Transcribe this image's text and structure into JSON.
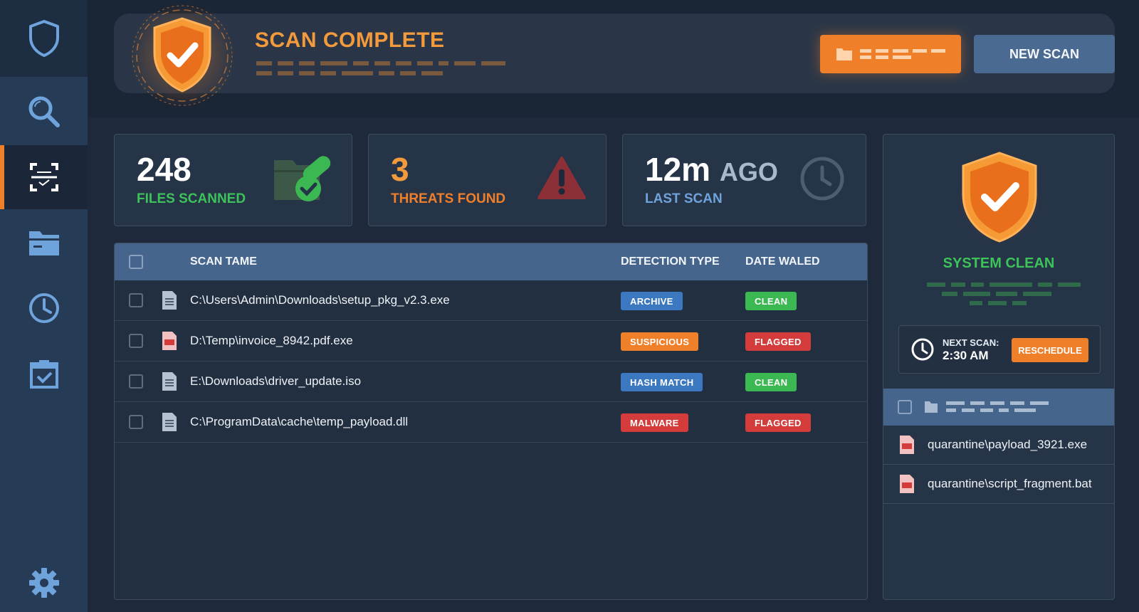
{
  "header": {
    "title": "SCAN COMPLETE",
    "new_scan_label": "NEW SCAN"
  },
  "stats": [
    {
      "value": "248",
      "label": "FILES SCANNED",
      "icon": "folder-check-icon"
    },
    {
      "value": "3",
      "label": "THREATS FOUND",
      "icon": "warning-icon"
    },
    {
      "value": "12m",
      "value_suffix": "AGO",
      "label": "LAST SCAN",
      "icon": "clock-icon"
    }
  ],
  "table": {
    "columns": [
      "SCAN TAME",
      "DETECTION TYPE",
      "DATE WALED"
    ],
    "rows": [
      {
        "path": "C:\\Users\\Admin\\Downloads\\setup_pkg_v2.3.exe",
        "detection": "ARCHIVE",
        "status": "CLEAN",
        "file_icon": "document-icon"
      },
      {
        "path": "D:\\Temp\\invoice_8942.pdf.exe",
        "detection": "SUSPICIOUS",
        "status": "FLAGGED",
        "file_icon": "pdf-file-icon"
      },
      {
        "path": "E:\\Downloads\\driver_update.iso",
        "detection": "HASH MATCH",
        "status": "CLEAN",
        "file_icon": "document-icon"
      },
      {
        "path": "C:\\ProgramData\\cache\\temp_payload.dll",
        "detection": "MALWARE",
        "status": "FLAGGED",
        "file_icon": "document-icon"
      }
    ]
  },
  "right_panel": {
    "title": "SYSTEM CLEAN",
    "next_scan_label": "NEXT SCAN:",
    "next_scan_time": "2:30 AM",
    "reschedule_label": "RESCHEDULE",
    "quarantine": [
      "quarantine\\payload_3921.exe",
      "quarantine\\script_fragment.bat"
    ]
  },
  "sidebar": {
    "items": [
      "shield-icon",
      "search-icon",
      "scan-icon",
      "folder-icon",
      "history-icon",
      "calendar-check-icon",
      "gear-icon"
    ],
    "active": "scan-icon"
  },
  "colors": {
    "accent": "#f07f2a",
    "clean": "#3cb852",
    "flagged": "#d43c3c",
    "info": "#3b78c0",
    "header_blue": "#46658c"
  }
}
